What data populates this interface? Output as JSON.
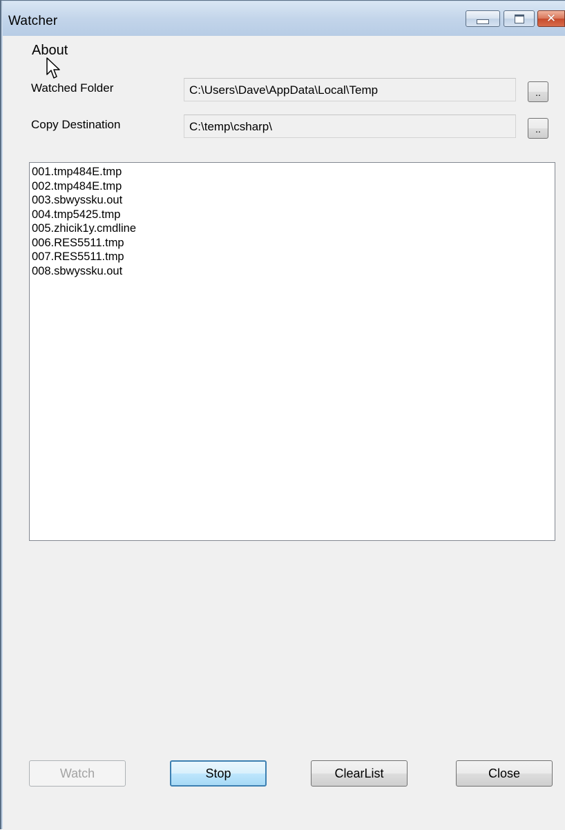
{
  "window": {
    "title": "Watcher"
  },
  "menu": {
    "items": [
      {
        "label": "About"
      }
    ]
  },
  "watched_folder": {
    "label": "Watched Folder",
    "value": "C:\\Users\\Dave\\AppData\\Local\\Temp",
    "browse_label": ".."
  },
  "copy_destination": {
    "label": "Copy Destination",
    "value": "C:\\temp\\csharp\\",
    "browse_label": ".."
  },
  "file_list": {
    "items": [
      "001.tmp484E.tmp",
      "002.tmp484E.tmp",
      "003.sbwyssku.out",
      "004.tmp5425.tmp",
      "005.zhicik1y.cmdline",
      "006.RES5511.tmp",
      "007.RES5511.tmp",
      "008.sbwyssku.out"
    ]
  },
  "buttons": {
    "watch": "Watch",
    "stop": "Stop",
    "clear_list": "ClearList",
    "close": "Close"
  },
  "icons": {
    "minimize": "minimize-icon",
    "maximize": "maximize-icon",
    "close": "close-icon",
    "cursor": "mouse-pointer-icon"
  },
  "colors": {
    "titlebar": "#c3d5ea",
    "close_button": "#c74b2c",
    "default_button_border": "#3c7fb1",
    "client_background": "#f0f0f0"
  }
}
